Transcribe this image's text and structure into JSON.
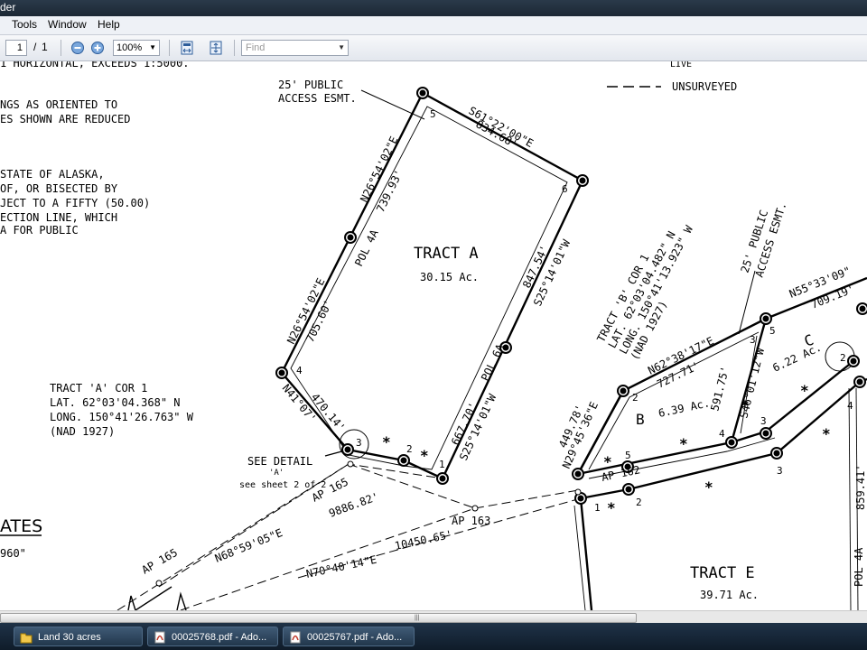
{
  "window": {
    "title_fragment": "der"
  },
  "menu": {
    "items": [
      "Tools",
      "Window",
      "Help"
    ]
  },
  "toolbar": {
    "page_current": "1",
    "page_separator": "/",
    "page_total": "1",
    "zoom": "100%",
    "find_placeholder": "Find"
  },
  "plat": {
    "notes": [
      "1 HORIZONTAL, EXCEEDS 1:5000.",
      "NGS AS ORIENTED TO",
      "ES SHOWN ARE REDUCED",
      "STATE OF ALASKA,",
      "OF, OR BISECTED BY",
      "JECT TO A FIFTY (50.00)",
      "ECTION LINE, WHICH",
      "A FOR PUBLIC"
    ],
    "legend": {
      "label": "UNSURVEYED",
      "top_fragment": "LIVE"
    },
    "tracts": [
      {
        "name": "TRACT A",
        "area": "30.15 Ac."
      },
      {
        "name": "TRACT E",
        "area": "39.71 Ac."
      },
      {
        "name": "B",
        "area": "6.39 Ac."
      },
      {
        "name": "C",
        "area": "6.22 Ac."
      }
    ],
    "easements": [
      [
        "25' PUBLIC",
        "ACCESS ESMT."
      ],
      [
        "25' PUBLIC",
        "ACCESS ESMT."
      ]
    ],
    "corner_a": [
      "TRACT 'A' COR 1",
      "LAT. 62°03'04.368\" N",
      "LONG. 150°41'26.763\" W",
      "(NAD 1927)"
    ],
    "corner_b": [
      "TRACT 'B' COR 1",
      "LAT. 62°03'04.482\" N",
      "LONG. 150°41'13.923\" W",
      "(NAD 1927)"
    ],
    "detail": [
      "SEE DETAIL",
      "'A'",
      "see sheet 2 of 2"
    ],
    "boundary_labels": [
      "S61°22'00\"E",
      "834.68'",
      "N26°54'02\"E",
      "739.93'",
      "POL 4A",
      "N26°54'02\"E",
      "705.60'",
      "847.54'",
      "S25°14'01\"W",
      "POL 6A",
      "667.70'",
      "S25°14'01\"W",
      "N41°07'",
      "470.14'",
      "N62°38'17\"E",
      "727.71'",
      "449.78'",
      "N29°45'36\"E",
      "591.75'",
      "S46°01'12\"W",
      "N55°33'09\"",
      "709.19'",
      "859.41'",
      "POL 4A"
    ],
    "ties": [
      "AP 165",
      "9886.82'",
      "N68°59'05\"E",
      "AP 165",
      "AP 163",
      "10450.65'",
      "N70°40'14\"E",
      "AP 162"
    ],
    "corner_numbers": [
      "1",
      "2",
      "3",
      "4",
      "5",
      "6",
      "1",
      "2",
      "3",
      "4",
      "5",
      "1",
      "2",
      "3",
      "4",
      "5",
      "1",
      "2",
      "2",
      "3",
      "4",
      "3"
    ],
    "states_fragment": "ATES",
    "scale_fragment": "960\""
  },
  "taskbar": {
    "items": [
      {
        "label": "Land 30 acres",
        "icon": "folder-icon"
      },
      {
        "label": "00025768.pdf - Ado...",
        "icon": "pdf-icon"
      },
      {
        "label": "00025767.pdf - Ado...",
        "icon": "pdf-icon"
      }
    ]
  }
}
